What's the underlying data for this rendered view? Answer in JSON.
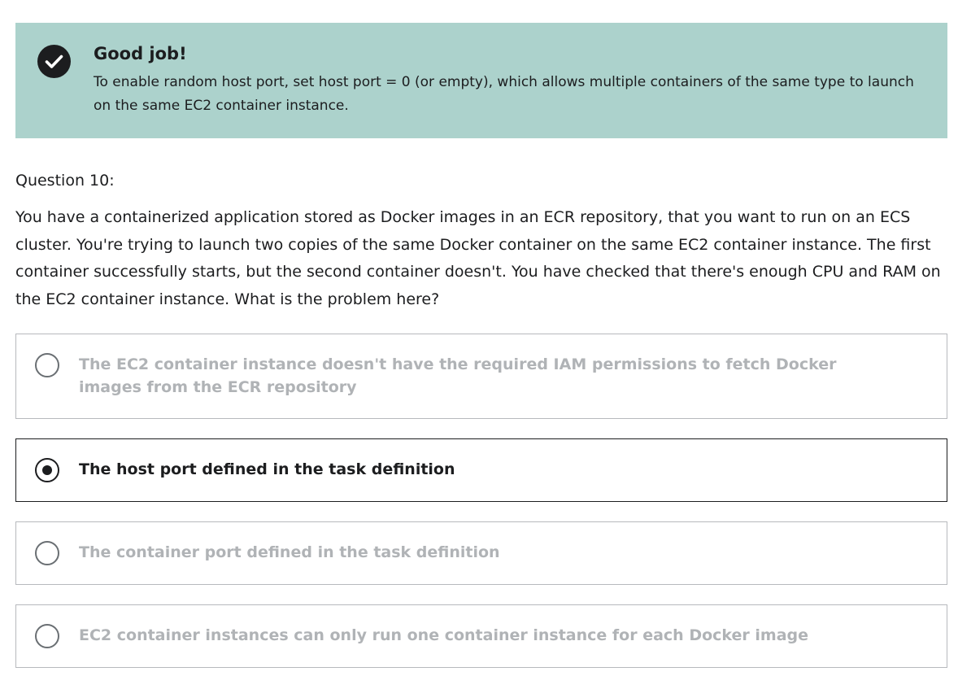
{
  "feedback": {
    "icon": "check-circle-icon",
    "title": "Good job!",
    "message": "To enable random host port, set host port = 0 (or empty), which allows multiple containers of the same type to launch on the same EC2 container instance."
  },
  "question": {
    "number_label": "Question 10:",
    "text": "You have a containerized application stored as Docker images in an ECR repository, that you want to run on an ECS cluster. You're trying to launch two copies of the same Docker container on the same EC2 container instance. The first container successfully starts, but the second container doesn't. You have checked that there's enough CPU and RAM on the EC2 container instance. What is the problem here?"
  },
  "answers": [
    {
      "label": "The EC2 container instance doesn't have the required IAM permissions to fetch Docker images from the ECR repository",
      "selected": false
    },
    {
      "label": "The host port defined in the task definition",
      "selected": true
    },
    {
      "label": "The container port defined in the task definition",
      "selected": false
    },
    {
      "label": "EC2 container instances can only run one container instance for each Docker image",
      "selected": false
    }
  ],
  "colors": {
    "banner_background": "#acd2cc",
    "text": "#1c1d1f",
    "unselected_answer_text": "#b0b3b6",
    "border": "#b7b9bd"
  }
}
